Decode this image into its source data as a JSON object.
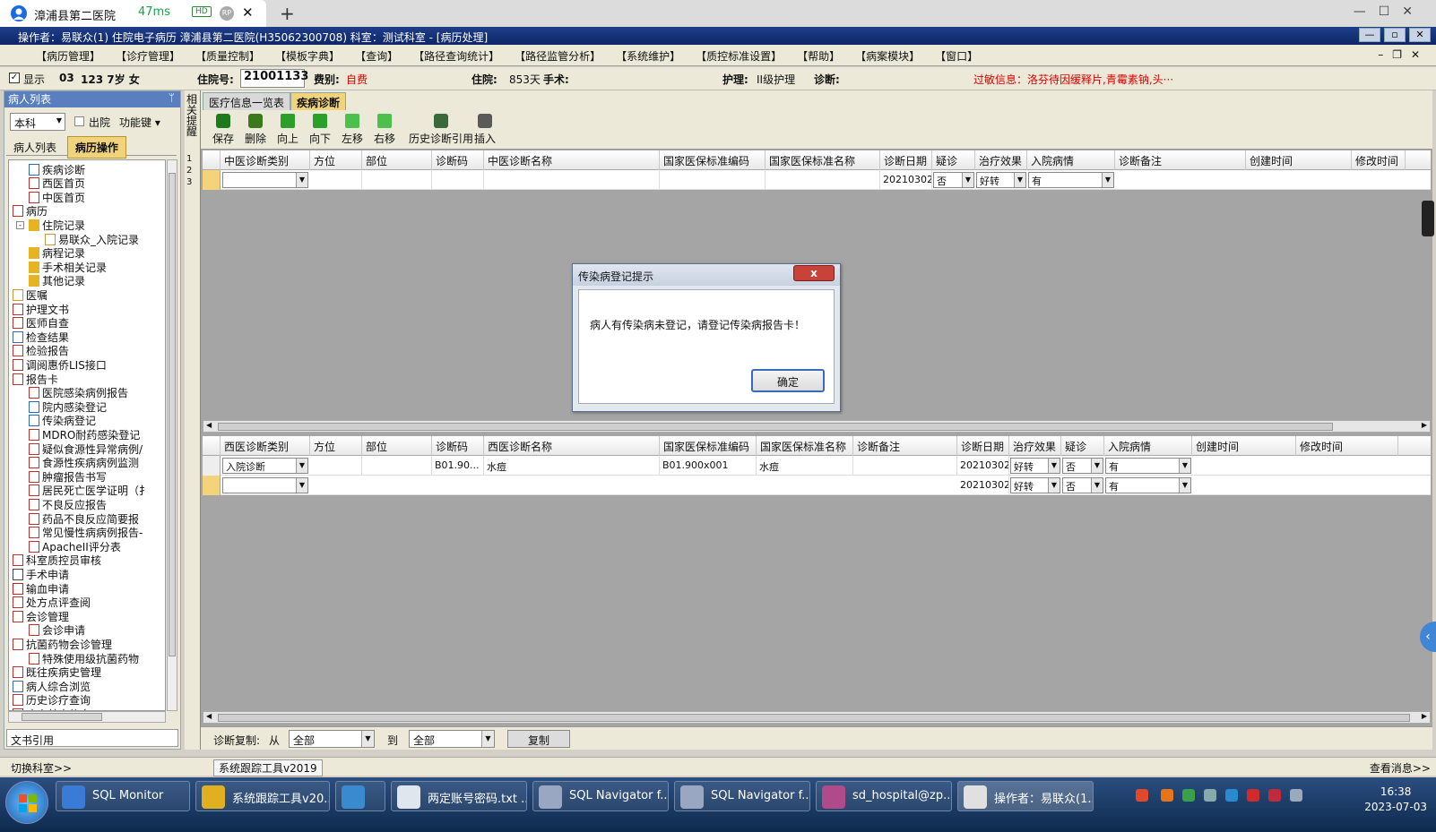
{
  "remote_tab": {
    "title": "漳浦县第二医院",
    "ping": "47ms",
    "hd": "HD",
    "rp": "RP"
  },
  "app_title": "操作者：易联众(1) 住院电子病历  漳浦县第二医院(H35062300708)  科室：测试科室 - [病历处理]",
  "menu": [
    "【病历管理】",
    "【诊疗管理】",
    "【质量控制】",
    "【模板字典】",
    "【查询】",
    "【路径查询统计】",
    "【路径监管分析】",
    "【系统维护】",
    "【质控标准设置】",
    "【帮助】",
    "【病案模块】",
    "【窗口】"
  ],
  "patient": {
    "show_label": "显示",
    "bed": "03",
    "age_sex": "123 7岁 女",
    "admission_label": "住院号:",
    "admission_no": "21001133",
    "fee_label": "费别:",
    "fee": "自费",
    "stay_label": "住院:",
    "stay": "853天",
    "surgery_label": "手术:",
    "nursing_label": "护理:",
    "nursing": "II级护理",
    "diagnosis_label": "诊断:",
    "allergy": "过敏信息：洛芬待因缓释片,青霉素钠,头···"
  },
  "left": {
    "header": "病人列表",
    "dept": "本科",
    "discharge": "出院",
    "func": "功能键",
    "tabs": [
      "病人列表",
      "病历操作"
    ],
    "footer": "文书引用",
    "tree": [
      {
        "label": "疾病诊断",
        "lvl": 1,
        "icon": "check-icon"
      },
      {
        "label": "西医首页",
        "lvl": 1,
        "icon": "doc-icon"
      },
      {
        "label": "中医首页",
        "lvl": 1,
        "icon": "doc-icon"
      },
      {
        "label": "病历",
        "lvl": 0,
        "icon": "doc-icon",
        "exp": "-"
      },
      {
        "label": "住院记录",
        "lvl": 1,
        "icon": "folder-icon",
        "exp": "-"
      },
      {
        "label": "易联众_入院记录",
        "lvl": 2,
        "icon": "note-icon"
      },
      {
        "label": "病程记录",
        "lvl": 1,
        "icon": "folder-icon"
      },
      {
        "label": "手术相关记录",
        "lvl": 1,
        "icon": "folder-icon"
      },
      {
        "label": "其他记录",
        "lvl": 1,
        "icon": "folder-icon"
      },
      {
        "label": "医嘱",
        "lvl": 0,
        "icon": "note-icon"
      },
      {
        "label": "护理文书",
        "lvl": 0,
        "icon": "doc-icon",
        "exp": "+"
      },
      {
        "label": "医师自查",
        "lvl": 0,
        "icon": "doc-icon"
      },
      {
        "label": "检查结果",
        "lvl": 0,
        "icon": "search-doc-icon"
      },
      {
        "label": "检验报告",
        "lvl": 0,
        "icon": "flask-icon"
      },
      {
        "label": "调阅惠侨LIS接口",
        "lvl": 0,
        "icon": "doc-icon"
      },
      {
        "label": "报告卡",
        "lvl": 0,
        "icon": "doc-icon",
        "exp": "-"
      },
      {
        "label": "医院感染病例报告",
        "lvl": 1,
        "icon": "doc-icon"
      },
      {
        "label": "院内感染登记",
        "lvl": 1,
        "icon": "check-icon"
      },
      {
        "label": "传染病登记",
        "lvl": 1,
        "icon": "chart-icon"
      },
      {
        "label": "MDRO耐药感染登记",
        "lvl": 1,
        "icon": "doc-icon"
      },
      {
        "label": "疑似食源性异常病例/",
        "lvl": 1,
        "icon": "doc-icon"
      },
      {
        "label": "食源性疾病病例监测",
        "lvl": 1,
        "icon": "doc-icon"
      },
      {
        "label": "肿瘤报告书写",
        "lvl": 1,
        "icon": "doc-icon"
      },
      {
        "label": "居民死亡医学证明（扌",
        "lvl": 1,
        "icon": "doc-icon"
      },
      {
        "label": "不良反应报告",
        "lvl": 1,
        "icon": "doc-icon"
      },
      {
        "label": "药品不良反应简要报",
        "lvl": 1,
        "icon": "doc-icon"
      },
      {
        "label": "常见慢性病病例报告-",
        "lvl": 1,
        "icon": "doc-icon"
      },
      {
        "label": "ApacheII评分表",
        "lvl": 1,
        "icon": "doc-icon"
      },
      {
        "label": "科室质控员审核",
        "lvl": 0,
        "icon": "doc-icon"
      },
      {
        "label": "手术申请",
        "lvl": 0,
        "icon": "scissors-icon"
      },
      {
        "label": "输血申请",
        "lvl": 0,
        "icon": "blood-icon"
      },
      {
        "label": "处方点评查阅",
        "lvl": 0,
        "icon": "doc-icon"
      },
      {
        "label": "会诊管理",
        "lvl": 0,
        "icon": "doc-icon",
        "exp": "-"
      },
      {
        "label": "会诊申请",
        "lvl": 1,
        "icon": "doc-icon"
      },
      {
        "label": "抗菌药物会诊管理",
        "lvl": 0,
        "icon": "doc-icon",
        "exp": "-"
      },
      {
        "label": "特殊使用级抗菌药物",
        "lvl": 1,
        "icon": "doc-icon"
      },
      {
        "label": "既往疾病史管理",
        "lvl": 0,
        "icon": "doc-icon"
      },
      {
        "label": "病人综合浏览",
        "lvl": 0,
        "icon": "search-doc-icon"
      },
      {
        "label": "历史诊疗查询",
        "lvl": 0,
        "icon": "doc-icon"
      },
      {
        "label": "病人基本信息",
        "lvl": 0,
        "icon": "doc-icon"
      }
    ]
  },
  "strip": {
    "vertical": "相关提醒",
    "nums": "1\n2\n3"
  },
  "main_tabs": [
    "医疗信息一览表",
    "疾病诊断"
  ],
  "toolbar": [
    {
      "label": "保存",
      "icon": "save-icon",
      "color": "#1c7a1c"
    },
    {
      "label": "删除",
      "icon": "delete-icon",
      "color": "#3b7a1c"
    },
    {
      "label": "向上",
      "icon": "arrow-up-icon",
      "color": "#2aa02a"
    },
    {
      "label": "向下",
      "icon": "arrow-down-icon",
      "color": "#2aa02a"
    },
    {
      "label": "左移",
      "icon": "arrow-left-icon",
      "color": "#4cc04c"
    },
    {
      "label": "右移",
      "icon": "arrow-right-icon",
      "color": "#4cc04c"
    },
    {
      "label": "历史诊断引用",
      "icon": "history-icon",
      "color": "#3a6a3a"
    },
    {
      "label": "插入",
      "icon": "insert-icon",
      "color": "#5a5a5a"
    }
  ],
  "tcm_grid": {
    "headers": [
      "中医诊断类别",
      "方位",
      "部位",
      "诊断码",
      "中医诊断名称",
      "国家医保标准编码",
      "国家医保标准名称",
      "诊断日期",
      "疑诊",
      "治疗效果",
      "入院病情",
      "诊断备注",
      "创建时间",
      "修改时间"
    ],
    "rows": [
      {
        "type": "",
        "date": "20210302",
        "suspect": "否",
        "effect": "好转",
        "cond": "有"
      }
    ]
  },
  "wm_grid": {
    "headers": [
      "西医诊断类别",
      "方位",
      "部位",
      "诊断码",
      "西医诊断名称",
      "国家医保标准编码",
      "国家医保标准名称",
      "诊断备注",
      "诊断日期",
      "治疗效果",
      "疑诊",
      "入院病情",
      "创建时间",
      "修改时间"
    ],
    "rows": [
      {
        "type": "入院诊断",
        "code": "B01.90...",
        "name": "水痘",
        "ns_code": "B01.900x001",
        "ns_name": "水痘",
        "date": "20210302",
        "effect": "好转",
        "suspect": "否",
        "cond": "有"
      },
      {
        "type": "",
        "code": "",
        "name": "",
        "ns_code": "",
        "ns_name": "",
        "date": "20210302",
        "effect": "好转",
        "suspect": "否",
        "cond": "有"
      }
    ]
  },
  "copybar": {
    "label": "诊断复制:",
    "from": "从",
    "from_val": "全部",
    "to": "到",
    "to_val": "全部",
    "btn": "复制"
  },
  "dialog": {
    "title": "传染病登记提示",
    "close": "x",
    "message": "病人有传染病未登记，请登记传染病报告卡！",
    "ok": "确定"
  },
  "status": {
    "left": "切换科室>>",
    "mid": "系统跟踪工具v2019",
    "right": "查看消息>>"
  },
  "taskbar": [
    {
      "label": "SQL Monitor",
      "color": "#3a7bd5"
    },
    {
      "label": "系统跟踪工具v20...",
      "color": "#e0b020"
    },
    {
      "label": "",
      "color": "#3a8ad0"
    },
    {
      "label": "两定账号密码.txt ...",
      "color": "#dfe6ee"
    },
    {
      "label": "SQL Navigator f...",
      "color": "#9aa7c2"
    },
    {
      "label": "SQL Navigator f...",
      "color": "#9aa7c2"
    },
    {
      "label": "sd_hospital@zp...",
      "color": "#b04a8a"
    },
    {
      "label": "操作者：易联众(1...",
      "color": "#e0e0e0"
    }
  ],
  "clock": {
    "time": "16:38",
    "date": "2023-07-03"
  }
}
